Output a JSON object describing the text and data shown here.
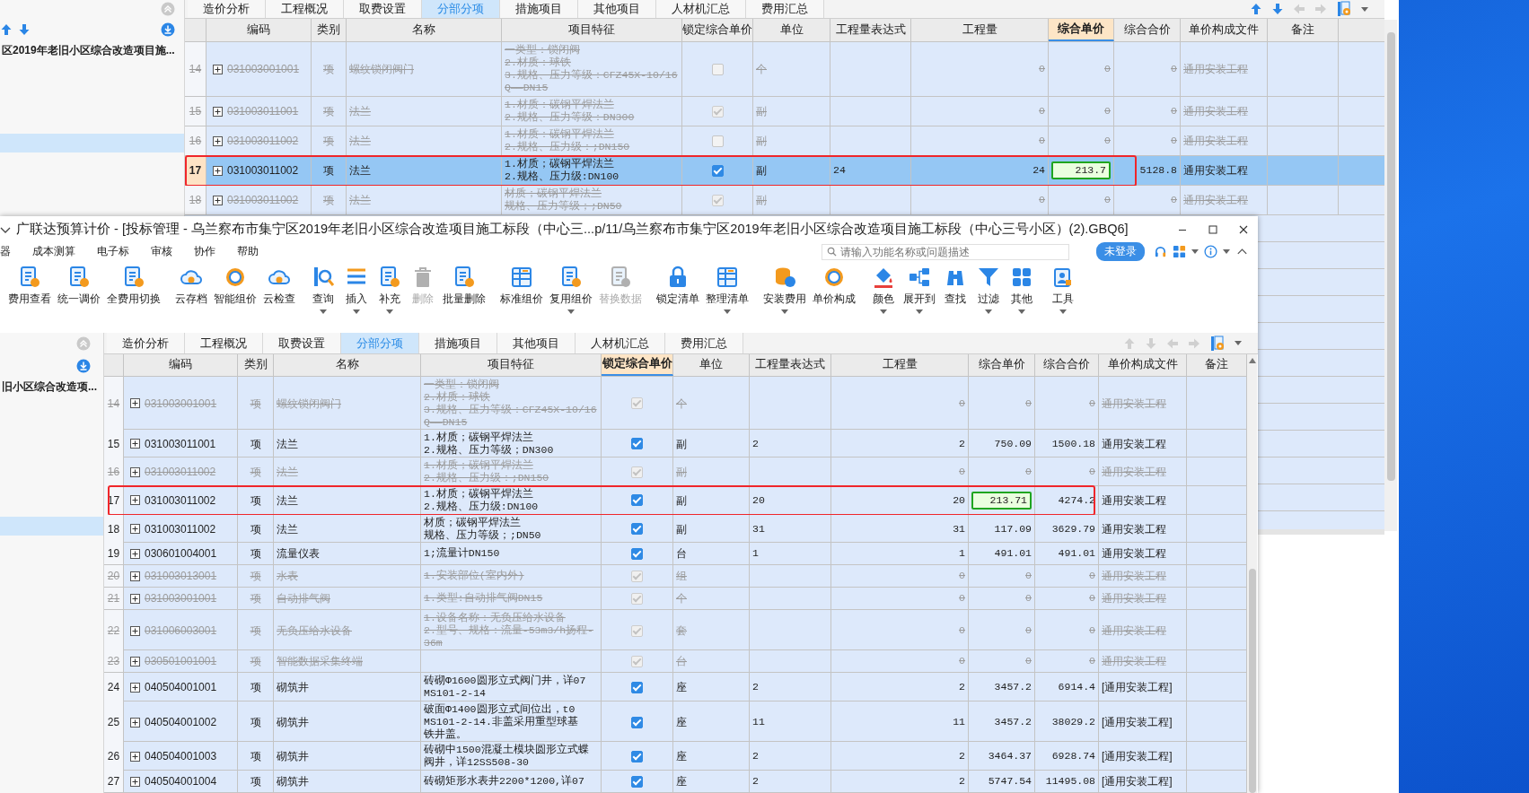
{
  "top_window": {
    "tree_items": [
      {
        "label": "区2019年老旧小区综合改造项目施...",
        "selected": false
      },
      {
        "selected": true
      }
    ],
    "tabs": [
      {
        "label": "造价分析",
        "selected": false
      },
      {
        "label": "工程概况",
        "selected": false
      },
      {
        "label": "取费设置",
        "selected": false
      },
      {
        "label": "分部分项",
        "selected": true
      },
      {
        "label": "措施项目",
        "selected": false
      },
      {
        "label": "其他项目",
        "selected": false
      },
      {
        "label": "人材机汇总",
        "selected": false
      },
      {
        "label": "费用汇总",
        "selected": false
      }
    ],
    "columns": [
      {
        "label": "编码",
        "selected": false
      },
      {
        "label": "类别",
        "selected": false
      },
      {
        "label": "名称",
        "selected": false
      },
      {
        "label": "项目特征",
        "selected": false
      },
      {
        "label": "锁定综合单价",
        "selected": false
      },
      {
        "label": "单位",
        "selected": false
      },
      {
        "label": "工程量表达式",
        "selected": false
      },
      {
        "label": "工程量",
        "selected": false
      },
      {
        "label": "综合单价",
        "selected": true
      },
      {
        "label": "综合合价",
        "selected": false
      },
      {
        "label": "单价构成文件",
        "selected": false
      },
      {
        "label": "备注",
        "selected": false
      }
    ],
    "rows": [
      {
        "no": "14",
        "code": "031003001001",
        "type": "项",
        "name": "螺纹锁闭阀门",
        "feature": [
          "一类型：锁闭阀",
          "2.材质：球铁",
          "3.规格、压力等级：CFZ45X-10/16Q——DN15"
        ],
        "locked": false,
        "unit": "个",
        "qty": "0",
        "price": "0",
        "total": "0",
        "file": "通用安装工程",
        "disabled": true,
        "selected": false
      },
      {
        "no": "15",
        "code": "031003011001",
        "type": "项",
        "name": "法兰",
        "feature": [
          "1.材质：碳钢平焊法兰",
          "2.规格、压力等级：DN300"
        ],
        "locked": true,
        "unit": "副",
        "qty": "0",
        "price": "0",
        "total": "0",
        "file": "通用安装工程",
        "disabled": true,
        "selected": false
      },
      {
        "no": "16",
        "code": "031003011002",
        "type": "项",
        "name": "法兰",
        "feature": [
          "1.材质：碳钢平焊法兰",
          "2.规格、压力级：;DN150"
        ],
        "locked": false,
        "unit": "副",
        "qty": "0",
        "price": "0",
        "total": "0",
        "file": "通用安装工程",
        "disabled": true,
        "selected": false
      },
      {
        "no": "17",
        "code": "031003011002",
        "type": "项",
        "name": "法兰",
        "feature": [
          "1.材质；碳钢平焊法兰",
          "2.规格、压力级:DN100"
        ],
        "locked": true,
        "unit": "副",
        "expr": "24",
        "qty": "24",
        "price": "213.7",
        "total": "5128.8",
        "file": "通用安装工程",
        "disabled": false,
        "selected": true,
        "marked": true,
        "price_marked": true
      },
      {
        "no": "18",
        "code": "031003011002",
        "type": "项",
        "name": "法兰",
        "feature": [
          "材质；碳钢平焊法兰",
          "规格、压力等级；;DN50"
        ],
        "locked": true,
        "unit": "副",
        "qty": "0",
        "price": "0",
        "total": "0",
        "file": "通用安装工程",
        "disabled": true,
        "selected": false
      }
    ]
  },
  "main_window": {
    "title": "广联达预算计价 - [投标管理 - 乌兰察布市集宁区2019年老旧小区综合改造项目施工标段（中心三...p/11/乌兰察布市集宁区2019年老旧小区综合改造项目施工标段（中心三号小区）(2).GBQ6]",
    "menu": [
      "器",
      "成本测算",
      "电子标",
      "审核",
      "协作",
      "帮助"
    ],
    "search": {
      "placeholder": "请输入功能名称或问题描述"
    },
    "login_button": "未登录",
    "toolbar_groups": [
      [
        {
          "label": "费用查看",
          "dropdown": false,
          "disabled": false
        },
        {
          "label": "统一调价",
          "dropdown": false,
          "disabled": false
        },
        {
          "label": "全费用切换",
          "dropdown": false,
          "disabled": false
        }
      ],
      [
        {
          "label": "云存档",
          "dropdown": false,
          "disabled": false
        },
        {
          "label": "智能组价",
          "dropdown": false,
          "disabled": false
        },
        {
          "label": "云检查",
          "dropdown": false,
          "disabled": false
        }
      ],
      [
        {
          "label": "查询",
          "dropdown": true,
          "disabled": false
        },
        {
          "label": "插入",
          "dropdown": true,
          "disabled": false
        },
        {
          "label": "补充",
          "dropdown": true,
          "disabled": false
        },
        {
          "label": "删除",
          "dropdown": false,
          "disabled": true
        },
        {
          "label": "批量删除",
          "dropdown": false,
          "disabled": false
        }
      ],
      [
        {
          "label": "标准组价",
          "dropdown": false,
          "disabled": false
        },
        {
          "label": "复用组价",
          "dropdown": true,
          "disabled": false
        },
        {
          "label": "替换数据",
          "dropdown": false,
          "disabled": true
        }
      ],
      [
        {
          "label": "锁定清单",
          "dropdown": false,
          "disabled": false
        },
        {
          "label": "整理清单",
          "dropdown": true,
          "disabled": false
        }
      ],
      [
        {
          "label": "安装费用",
          "dropdown": true,
          "disabled": false
        },
        {
          "label": "单价构成",
          "dropdown": false,
          "disabled": false
        }
      ],
      [
        {
          "label": "颜色",
          "dropdown": true,
          "disabled": false
        },
        {
          "label": "展开到",
          "dropdown": true,
          "disabled": false
        },
        {
          "label": "查找",
          "dropdown": false,
          "disabled": false
        },
        {
          "label": "过滤",
          "dropdown": true,
          "disabled": false
        },
        {
          "label": "其他",
          "dropdown": true,
          "disabled": false
        }
      ],
      [
        {
          "label": "工具",
          "dropdown": true,
          "disabled": false
        }
      ]
    ],
    "tree_items": [
      {
        "label": "旧小区综合改造项...",
        "selected": false
      },
      {
        "selected": true
      }
    ],
    "tabs": [
      {
        "label": "造价分析",
        "selected": false
      },
      {
        "label": "工程概况",
        "selected": false
      },
      {
        "label": "取费设置",
        "selected": false
      },
      {
        "label": "分部分项",
        "selected": true
      },
      {
        "label": "措施项目",
        "selected": false
      },
      {
        "label": "其他项目",
        "selected": false
      },
      {
        "label": "人材机汇总",
        "selected": false
      },
      {
        "label": "费用汇总",
        "selected": false
      }
    ],
    "columns": [
      {
        "label": "编码",
        "selected": false
      },
      {
        "label": "类别",
        "selected": false
      },
      {
        "label": "名称",
        "selected": false
      },
      {
        "label": "项目特征",
        "selected": false
      },
      {
        "label": "锁定综合单价",
        "selected": true
      },
      {
        "label": "单位",
        "selected": false
      },
      {
        "label": "工程量表达式",
        "selected": false
      },
      {
        "label": "工程量",
        "selected": false
      },
      {
        "label": "综合单价",
        "selected": false
      },
      {
        "label": "综合合价",
        "selected": false
      },
      {
        "label": "单价构成文件",
        "selected": false
      },
      {
        "label": "备注",
        "selected": false
      }
    ],
    "rows": [
      {
        "no": "14",
        "code": "031003001001",
        "type": "项",
        "name": "螺纹锁闭阀门",
        "feature": [
          "一类型：锁闭阀",
          "2.材质：球铁",
          "3.规格、压力等级：CFZ45X-10/16Q——DN15"
        ],
        "locked": true,
        "unit": "个",
        "qty": "0",
        "price": "0",
        "total": "0",
        "file": "通用安装工程",
        "disabled": true,
        "selected": false
      },
      {
        "no": "15",
        "code": "031003011001",
        "type": "项",
        "name": "法兰",
        "feature": [
          "1.材质；碳钢平焊法兰",
          "2.规格、压力等级；DN300"
        ],
        "locked": true,
        "unit": "副",
        "expr": "2",
        "qty": "2",
        "price": "750.09",
        "total": "1500.18",
        "file": "通用安装工程",
        "disabled": false,
        "selected": false
      },
      {
        "no": "16",
        "code": "031003011002",
        "type": "项",
        "name": "法兰",
        "feature": [
          "1.材质；碳钢平焊法兰",
          "2.规格、压力级：;DN150"
        ],
        "locked": true,
        "unit": "副",
        "qty": "0",
        "price": "0",
        "total": "0",
        "file": "通用安装工程",
        "disabled": true,
        "selected": false
      },
      {
        "no": "17",
        "code": "031003011002",
        "type": "项",
        "name": "法兰",
        "feature": [
          "1.材质；碳钢平焊法兰",
          "2.规格、压力级:DN100"
        ],
        "locked": true,
        "unit": "副",
        "expr": "20",
        "qty": "20",
        "price": "213.71",
        "total": "4274.2",
        "file": "通用安装工程",
        "disabled": false,
        "selected": false,
        "marked": true,
        "price_marked": true
      },
      {
        "no": "18",
        "code": "031003011002",
        "type": "项",
        "name": "法兰",
        "feature": [
          "材质；碳钢平焊法兰",
          "规格、压力等级；;DN50"
        ],
        "locked": true,
        "unit": "副",
        "expr": "31",
        "qty": "31",
        "price": "117.09",
        "total": "3629.79",
        "file": "通用安装工程",
        "disabled": false,
        "selected": false
      },
      {
        "no": "19",
        "code": "030601004001",
        "type": "项",
        "name": "流量仪表",
        "feature": [
          "1;流量计DN150"
        ],
        "locked": true,
        "unit": "台",
        "expr": "1",
        "qty": "1",
        "price": "491.01",
        "total": "491.01",
        "file": "通用安装工程",
        "disabled": false,
        "selected": false
      },
      {
        "no": "20",
        "code": "031003013001",
        "type": "项",
        "name": "水表",
        "feature": [
          "1.安装部位(室内外)"
        ],
        "locked": true,
        "unit": "组",
        "qty": "0",
        "price": "0",
        "total": "0",
        "file": "通用安装工程",
        "disabled": true,
        "selected": false
      },
      {
        "no": "21",
        "code": "031003001001",
        "type": "项",
        "name": "自动排气阀",
        "feature": [
          "1.类型:自动排气阀DN15"
        ],
        "locked": true,
        "unit": "个",
        "qty": "0",
        "price": "0",
        "total": "0",
        "file": "通用安装工程",
        "disabled": true,
        "selected": false
      },
      {
        "no": "22",
        "code": "031006003001",
        "type": "项",
        "name": "无负压给水设备",
        "feature": [
          "1.设备名称：无负压给水设备",
          "2.型号、规格：流量-53m3/h扬程-36m"
        ],
        "locked": true,
        "unit": "套",
        "qty": "0",
        "price": "0",
        "total": "0",
        "file": "通用安装工程",
        "disabled": true,
        "selected": false
      },
      {
        "no": "23",
        "code": "030501001001",
        "type": "项",
        "name": "智能数据采集终端",
        "locked": true,
        "unit": "台",
        "qty": "0",
        "price": "0",
        "total": "0",
        "file": "通用安装工程",
        "disabled": true,
        "selected": false
      },
      {
        "no": "24",
        "code": "040504001001",
        "type": "项",
        "name": "砌筑井",
        "feature": [
          "砖砌Φ1600圆形立式阀门井，详07",
          "MS101-2-14"
        ],
        "locked": true,
        "unit": "座",
        "expr": "2",
        "qty": "2",
        "price": "3457.2",
        "total": "6914.4",
        "file": "[通用安装工程]",
        "disabled": false,
        "selected": false
      },
      {
        "no": "25",
        "code": "040504001002",
        "type": "项",
        "name": "砌筑井",
        "feature": [
          "破面Φ1400圆形立式间位出，t0",
          "MS101-2-14.非盖采用重型球基",
          "铁井盖。"
        ],
        "locked": true,
        "unit": "座",
        "expr": "11",
        "qty": "11",
        "price": "3457.2",
        "total": "38029.2",
        "file": "[通用安装工程]",
        "disabled": false,
        "selected": false
      },
      {
        "no": "26",
        "code": "040504001003",
        "type": "项",
        "name": "砌筑井",
        "feature": [
          "砖砌中1500混凝土模块圆形立式蝶",
          "阀井，详12SS508-30"
        ],
        "locked": true,
        "unit": "座",
        "expr": "2",
        "qty": "2",
        "price": "3464.37",
        "total": "6928.74",
        "file": "[通用安装工程]",
        "disabled": false,
        "selected": false
      },
      {
        "no": "27",
        "code": "040504001004",
        "type": "项",
        "name": "砌筑井",
        "feature": [
          "砖砌矩形水表井2200*1200,详07"
        ],
        "locked": true,
        "unit": "座",
        "expr": "2",
        "qty": "2",
        "price": "5747.54",
        "total": "11495.08",
        "file": "[通用安装工程]",
        "disabled": false,
        "selected": false
      }
    ]
  }
}
